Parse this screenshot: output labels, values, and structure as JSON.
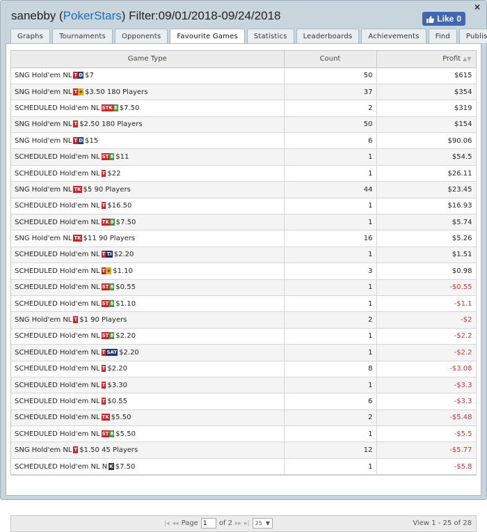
{
  "header": {
    "user": "sanebby",
    "site": "PokerStars",
    "filter": "Filter:09/01/2018-09/24/2018",
    "like_label": "Like",
    "like_count": "0",
    "close": "×"
  },
  "tabs": [
    "Graphs",
    "Tournaments",
    "Opponents",
    "Favourite Games",
    "Statistics",
    "Leaderboards",
    "Achievements",
    "Find",
    "Publish"
  ],
  "active_tab": "Favourite Games",
  "grid": {
    "columns": [
      "Game Type",
      "Count",
      "Profit"
    ],
    "rows": [
      {
        "pre": "SNG Hold'em NL",
        "badges": [
          {
            "t": "T",
            "c": "red"
          },
          {
            "t": "D",
            "c": "blue"
          }
        ],
        "post": "$7",
        "count": "50",
        "profit": "$615"
      },
      {
        "pre": "SNG Hold'em NL",
        "badges": [
          {
            "t": "T",
            "c": "red"
          },
          {
            "t": "+",
            "c": "yellow"
          }
        ],
        "post": "$3.50 180 Players",
        "count": "37",
        "profit": "$354"
      },
      {
        "pre": "SCHEDULED Hold'em NL",
        "badges": [
          {
            "t": "STK",
            "c": "red"
          },
          {
            "t": "8",
            "c": "green"
          }
        ],
        "post": "$7.50",
        "count": "2",
        "profit": "$319"
      },
      {
        "pre": "SNG Hold'em NL",
        "badges": [
          {
            "t": "T",
            "c": "red"
          }
        ],
        "post": "$2.50 180 Players",
        "count": "50",
        "profit": "$154"
      },
      {
        "pre": "SNG Hold'em NL",
        "badges": [
          {
            "t": "T",
            "c": "red"
          },
          {
            "t": "D",
            "c": "blue"
          }
        ],
        "post": "$15",
        "count": "6",
        "profit": "$90.06"
      },
      {
        "pre": "SCHEDULED Hold'em NL",
        "badges": [
          {
            "t": "ST",
            "c": "red"
          },
          {
            "t": "8",
            "c": "green"
          }
        ],
        "post": "$11",
        "count": "1",
        "profit": "$54.5"
      },
      {
        "pre": "SCHEDULED Hold'em NL",
        "badges": [
          {
            "t": "T",
            "c": "red"
          }
        ],
        "post": "$22",
        "count": "1",
        "profit": "$26.11"
      },
      {
        "pre": "SNG Hold'em NL",
        "badges": [
          {
            "t": "TK",
            "c": "red"
          }
        ],
        "post": "$5 90 Players",
        "count": "44",
        "profit": "$23.45"
      },
      {
        "pre": "SCHEDULED Hold'em NL",
        "badges": [
          {
            "t": "T",
            "c": "red"
          }
        ],
        "post": "$16.50",
        "count": "1",
        "profit": "$16.93"
      },
      {
        "pre": "SCHEDULED Hold'em NL",
        "badges": [
          {
            "t": "TK",
            "c": "red"
          },
          {
            "t": "8",
            "c": "green"
          }
        ],
        "post": "$7.50",
        "count": "1",
        "profit": "$5.74"
      },
      {
        "pre": "SNG Hold'em NL",
        "badges": [
          {
            "t": "TK",
            "c": "red"
          }
        ],
        "post": "$11 90 Players",
        "count": "16",
        "profit": "$5.26"
      },
      {
        "pre": "SCHEDULED Hold'em NL",
        "badges": [
          {
            "t": "T",
            "c": "red"
          },
          {
            "t": "TI",
            "c": "navy"
          }
        ],
        "post": "$2.20",
        "count": "1",
        "profit": "$1.51"
      },
      {
        "pre": "SCHEDULED Hold'em NL",
        "badges": [
          {
            "t": "T",
            "c": "red"
          },
          {
            "t": "+",
            "c": "yellow"
          }
        ],
        "post": "$1.10",
        "count": "3",
        "profit": "$0.98"
      },
      {
        "pre": "SCHEDULED Hold'em NL",
        "badges": [
          {
            "t": "ST",
            "c": "red"
          },
          {
            "t": "8",
            "c": "green"
          }
        ],
        "post": "$0.55",
        "count": "1",
        "profit": "-$0.55"
      },
      {
        "pre": "SCHEDULED Hold'em NL",
        "badges": [
          {
            "t": "ST",
            "c": "red"
          },
          {
            "t": "8",
            "c": "green"
          }
        ],
        "post": "$1.10",
        "count": "1",
        "profit": "-$1.1"
      },
      {
        "pre": "SNG Hold'em NL",
        "badges": [
          {
            "t": "T",
            "c": "red"
          }
        ],
        "post": "$1 90 Players",
        "count": "2",
        "profit": "-$2"
      },
      {
        "pre": "SCHEDULED Hold'em NL",
        "badges": [
          {
            "t": "ST",
            "c": "red"
          },
          {
            "t": "8",
            "c": "green"
          }
        ],
        "post": "$2.20",
        "count": "1",
        "profit": "-$2.2"
      },
      {
        "pre": "SCHEDULED Hold'em NL",
        "badges": [
          {
            "t": "T",
            "c": "red"
          },
          {
            "t": "SAT",
            "c": "navy"
          }
        ],
        "post": "$2.20",
        "count": "1",
        "profit": "-$2.2"
      },
      {
        "pre": "SCHEDULED Hold'em NL",
        "badges": [
          {
            "t": "T",
            "c": "red"
          }
        ],
        "post": "$2.20",
        "count": "8",
        "profit": "-$3.08"
      },
      {
        "pre": "SCHEDULED Hold'em NL",
        "badges": [
          {
            "t": "T",
            "c": "red"
          }
        ],
        "post": "$3.30",
        "count": "1",
        "profit": "-$3.3"
      },
      {
        "pre": "SCHEDULED Hold'em NL",
        "badges": [
          {
            "t": "T",
            "c": "red"
          }
        ],
        "post": "$0.55",
        "count": "6",
        "profit": "-$3.3"
      },
      {
        "pre": "SCHEDULED Hold'em NL",
        "badges": [
          {
            "t": "TK",
            "c": "red"
          }
        ],
        "post": "$5.50",
        "count": "2",
        "profit": "-$5.48"
      },
      {
        "pre": "SCHEDULED Hold'em NL",
        "badges": [
          {
            "t": "ST",
            "c": "red"
          },
          {
            "t": "8",
            "c": "green"
          }
        ],
        "post": "$5.50",
        "count": "1",
        "profit": "-$5.5"
      },
      {
        "pre": "SNG Hold'em NL",
        "badges": [
          {
            "t": "T",
            "c": "red"
          }
        ],
        "post": "$1.50 45 Players",
        "count": "12",
        "profit": "-$5.77"
      },
      {
        "pre": "SCHEDULED Hold'em NL N",
        "badges": [
          {
            "t": "K",
            "c": "dark"
          }
        ],
        "post": "$7.50",
        "count": "1",
        "profit": "-$5.8"
      }
    ]
  },
  "pager": {
    "page_label": "Page",
    "page_value": "1",
    "of_label": "of 2",
    "page_size": "25",
    "view_text": "View 1 - 25 of 28"
  },
  "colors": {
    "accent": "#1a6dbb",
    "negative": "#cc3333",
    "like_button": "#4267b2"
  }
}
